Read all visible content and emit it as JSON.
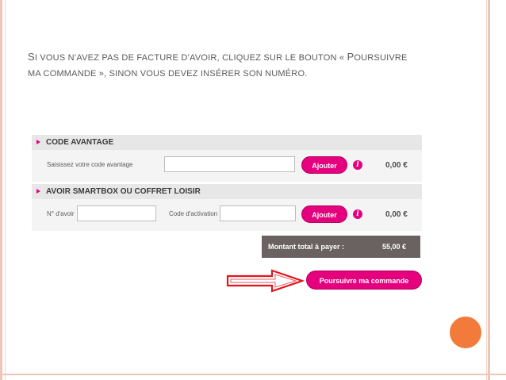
{
  "slide": {
    "line1_first": "S",
    "line1_rest": "i vous n’avez pas de facture d’avoir, cliquez sur le bouton « ",
    "line1_cap": "P",
    "line1_end": "oursuivre",
    "line2": "ma commande », sinon vous devez insérer son numéro."
  },
  "form": {
    "code_avantage": {
      "title": "CODE AVANTAGE",
      "label": "Saisissez votre code avantage",
      "input_value": "",
      "button": "Ajouter",
      "info": "i",
      "amount": "0,00 €"
    },
    "avoir": {
      "title": "AVOIR SMARTBOX OU COFFRET LOISIR",
      "label_avoir": "N° d'avoir",
      "label_activation": "Code d'activation",
      "avoir_value": "",
      "activation_value": "",
      "button": "Ajouter",
      "info": "i",
      "amount": "0,00 €"
    },
    "total": {
      "label": "Montant total à payer :",
      "value": "55,00 €"
    },
    "continue_button": "Poursuivre ma commande"
  },
  "colors": {
    "accent": "#e5007e",
    "total_bg": "#6a6261",
    "arrow": "#e3141b",
    "orange_dot": "#f27a3a"
  }
}
